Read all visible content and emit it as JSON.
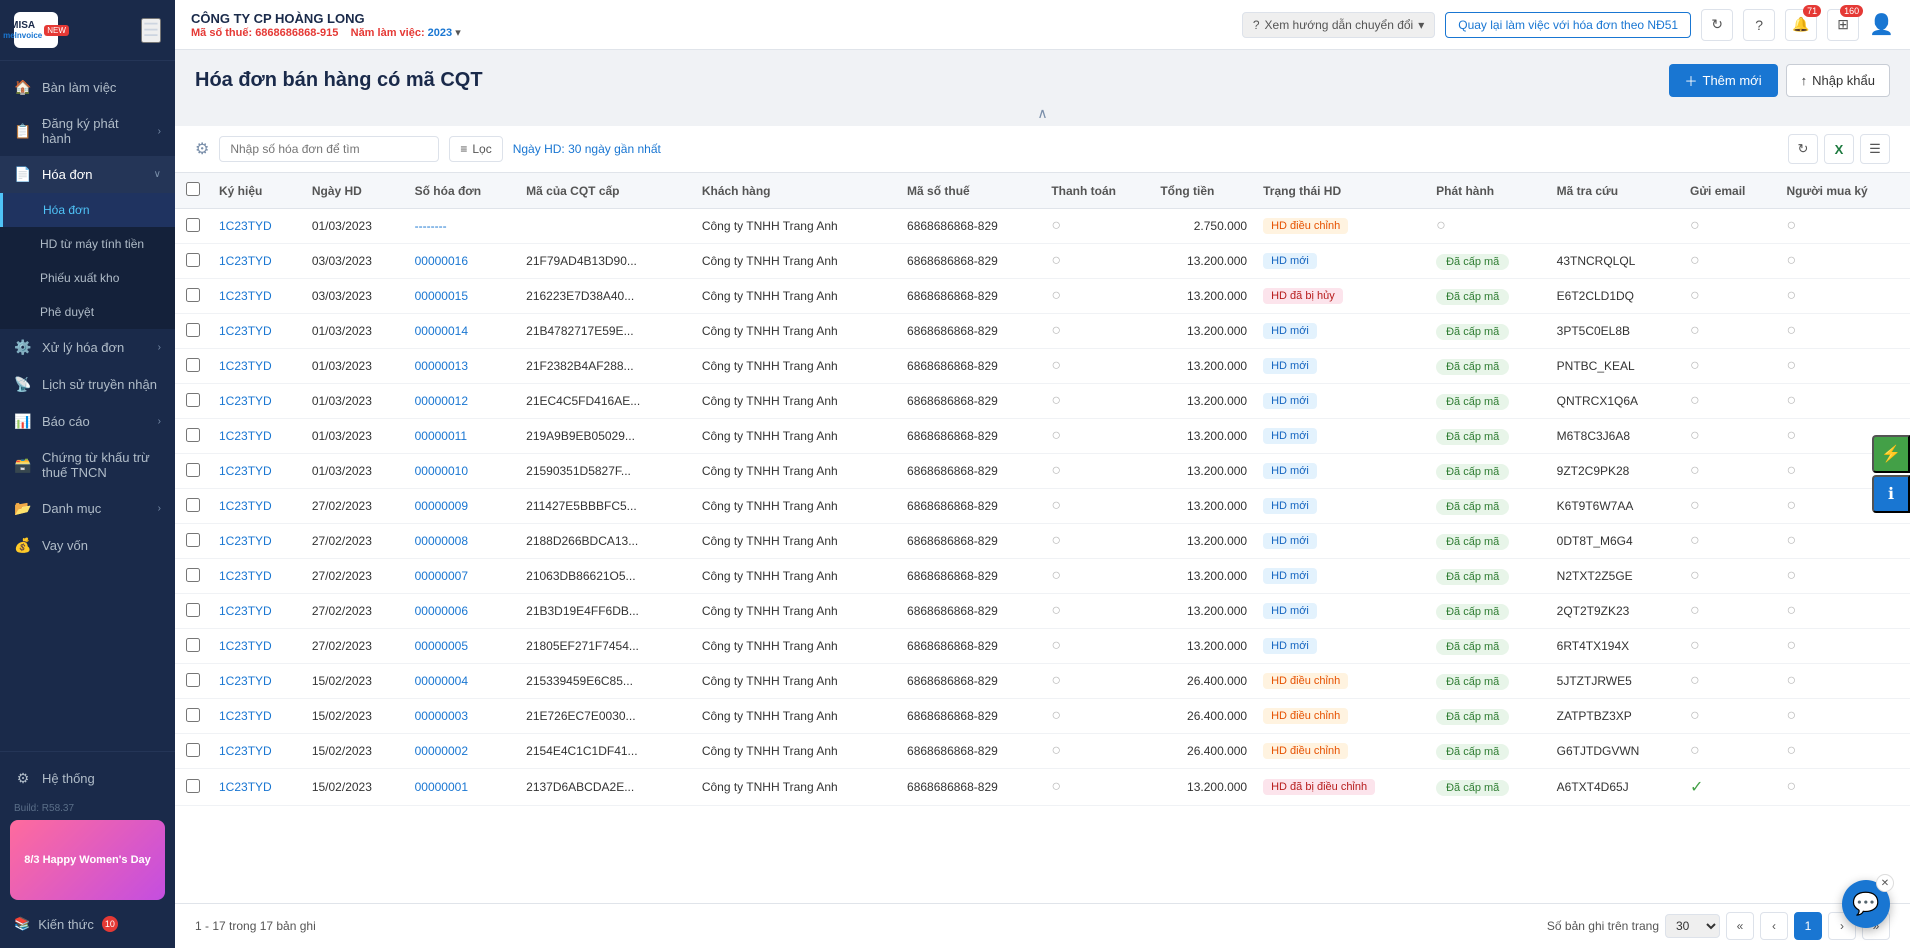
{
  "app": {
    "name": "MISA",
    "sub": "meInvoice",
    "badge": "NEW"
  },
  "company": {
    "name": "CÔNG TY CP HOÀNG LONG",
    "tax_label": "Mã số thuế:",
    "tax_number": "6868686868-915",
    "year_label": "Năm làm việc:",
    "year": "2023"
  },
  "header": {
    "help_text": "Xem hướng dẫn chuyển đổi",
    "nd51_btn": "Quay lại làm việc với hóa đơn theo NĐ51",
    "notification_count": "71",
    "apps_count": "160"
  },
  "page": {
    "title": "Hóa đơn bán hàng có mã CQT",
    "add_btn": "Thêm mới",
    "import_btn": "Nhập khẩu"
  },
  "filter": {
    "search_placeholder": "Nhập số hóa đơn để tìm",
    "filter_label": "Lọc",
    "date_label": "Ngày HD:",
    "date_range": "30 ngày gần nhất"
  },
  "table": {
    "columns": [
      "Ký hiệu",
      "Ngày HD",
      "Số hóa đơn",
      "Mã của CQT cấp",
      "Khách hàng",
      "Mã số thuế",
      "Thanh toán",
      "Tổng tiền",
      "Trạng thái HD",
      "Phát hành",
      "Mã tra cứu",
      "Gửi email",
      "Người mua ký"
    ],
    "rows": [
      {
        "ky_hieu": "1C23TYD",
        "ngay_hd": "01/03/2023",
        "so_hd": "--------",
        "ma_cqt": "",
        "khach_hang": "Công ty TNHH Trang Anh",
        "ma_so_thue": "6868686868-829",
        "thanh_toan": "",
        "tong_tien": "2.750.000",
        "trang_thai": "HD điều chỉnh",
        "trang_thai_class": "badge-hd-dieu-chinh",
        "phat_hanh": "",
        "ma_tra_cuu": "",
        "gui_email": "",
        "nguoi_mua_ky": ""
      },
      {
        "ky_hieu": "1C23TYD",
        "ngay_hd": "03/03/2023",
        "so_hd": "00000016",
        "ma_cqt": "21F79AD4B13D90...",
        "khach_hang": "Công ty TNHH Trang Anh",
        "ma_so_thue": "6868686868-829",
        "thanh_toan": "",
        "tong_tien": "13.200.000",
        "trang_thai": "HD mới",
        "trang_thai_class": "badge-hd-moi",
        "phat_hanh": "Đã cấp mã",
        "ma_tra_cuu": "43TNCRQLQL",
        "gui_email": "",
        "nguoi_mua_ky": ""
      },
      {
        "ky_hieu": "1C23TYD",
        "ngay_hd": "03/03/2023",
        "so_hd": "00000015",
        "ma_cqt": "216223E7D38A40...",
        "khach_hang": "Công ty TNHH Trang Anh",
        "ma_so_thue": "6868686868-829",
        "thanh_toan": "",
        "tong_tien": "13.200.000",
        "trang_thai": "HD đã bị hủy",
        "trang_thai_class": "badge-hd-da-bi-huy",
        "phat_hanh": "Đã cấp mã",
        "ma_tra_cuu": "E6T2CLD1DQ",
        "gui_email": "",
        "nguoi_mua_ky": ""
      },
      {
        "ky_hieu": "1C23TYD",
        "ngay_hd": "01/03/2023",
        "so_hd": "00000014",
        "ma_cqt": "21B4782717E59E...",
        "khach_hang": "Công ty TNHH Trang Anh",
        "ma_so_thue": "6868686868-829",
        "thanh_toan": "",
        "tong_tien": "13.200.000",
        "trang_thai": "HD mới",
        "trang_thai_class": "badge-hd-moi",
        "phat_hanh": "Đã cấp mã",
        "ma_tra_cuu": "3PT5C0EL8B",
        "gui_email": "",
        "nguoi_mua_ky": ""
      },
      {
        "ky_hieu": "1C23TYD",
        "ngay_hd": "01/03/2023",
        "so_hd": "00000013",
        "ma_cqt": "21F2382B4AF288...",
        "khach_hang": "Công ty TNHH Trang Anh",
        "ma_so_thue": "6868686868-829",
        "thanh_toan": "",
        "tong_tien": "13.200.000",
        "trang_thai": "HD mới",
        "trang_thai_class": "badge-hd-moi",
        "phat_hanh": "Đã cấp mã",
        "ma_tra_cuu": "PNTBC_KEAL",
        "gui_email": "",
        "nguoi_mua_ky": ""
      },
      {
        "ky_hieu": "1C23TYD",
        "ngay_hd": "01/03/2023",
        "so_hd": "00000012",
        "ma_cqt": "21EC4C5FD416AE...",
        "khach_hang": "Công ty TNHH Trang Anh",
        "ma_so_thue": "6868686868-829",
        "thanh_toan": "",
        "tong_tien": "13.200.000",
        "trang_thai": "HD mới",
        "trang_thai_class": "badge-hd-moi",
        "phat_hanh": "Đã cấp mã",
        "ma_tra_cuu": "QNTRCX1Q6A",
        "gui_email": "",
        "nguoi_mua_ky": ""
      },
      {
        "ky_hieu": "1C23TYD",
        "ngay_hd": "01/03/2023",
        "so_hd": "00000011",
        "ma_cqt": "219A9B9EB05029...",
        "khach_hang": "Công ty TNHH Trang Anh",
        "ma_so_thue": "6868686868-829",
        "thanh_toan": "",
        "tong_tien": "13.200.000",
        "trang_thai": "HD mới",
        "trang_thai_class": "badge-hd-moi",
        "phat_hanh": "Đã cấp mã",
        "ma_tra_cuu": "M6T8C3J6A8",
        "gui_email": "",
        "nguoi_mua_ky": ""
      },
      {
        "ky_hieu": "1C23TYD",
        "ngay_hd": "01/03/2023",
        "so_hd": "00000010",
        "ma_cqt": "21590351D5827F...",
        "khach_hang": "Công ty TNHH Trang Anh",
        "ma_so_thue": "6868686868-829",
        "thanh_toan": "",
        "tong_tien": "13.200.000",
        "trang_thai": "HD mới",
        "trang_thai_class": "badge-hd-moi",
        "phat_hanh": "Đã cấp mã",
        "ma_tra_cuu": "9ZT2C9PK28",
        "gui_email": "",
        "nguoi_mua_ky": ""
      },
      {
        "ky_hieu": "1C23TYD",
        "ngay_hd": "27/02/2023",
        "so_hd": "00000009",
        "ma_cqt": "211427E5BBBFC5...",
        "khach_hang": "Công ty TNHH Trang Anh",
        "ma_so_thue": "6868686868-829",
        "thanh_toan": "",
        "tong_tien": "13.200.000",
        "trang_thai": "HD mới",
        "trang_thai_class": "badge-hd-moi",
        "phat_hanh": "Đã cấp mã",
        "ma_tra_cuu": "K6T9T6W7AA",
        "gui_email": "",
        "nguoi_mua_ky": ""
      },
      {
        "ky_hieu": "1C23TYD",
        "ngay_hd": "27/02/2023",
        "so_hd": "00000008",
        "ma_cqt": "2188D266BDCA13...",
        "khach_hang": "Công ty TNHH Trang Anh",
        "ma_so_thue": "6868686868-829",
        "thanh_toan": "",
        "tong_tien": "13.200.000",
        "trang_thai": "HD mới",
        "trang_thai_class": "badge-hd-moi",
        "phat_hanh": "Đã cấp mã",
        "ma_tra_cuu": "0DT8T_M6G4",
        "gui_email": "",
        "nguoi_mua_ky": ""
      },
      {
        "ky_hieu": "1C23TYD",
        "ngay_hd": "27/02/2023",
        "so_hd": "00000007",
        "ma_cqt": "21063DB86621O5...",
        "khach_hang": "Công ty TNHH Trang Anh",
        "ma_so_thue": "6868686868-829",
        "thanh_toan": "",
        "tong_tien": "13.200.000",
        "trang_thai": "HD mới",
        "trang_thai_class": "badge-hd-moi",
        "phat_hanh": "Đã cấp mã",
        "ma_tra_cuu": "N2TXT2Z5GE",
        "gui_email": "",
        "nguoi_mua_ky": ""
      },
      {
        "ky_hieu": "1C23TYD",
        "ngay_hd": "27/02/2023",
        "so_hd": "00000006",
        "ma_cqt": "21B3D19E4FF6DB...",
        "khach_hang": "Công ty TNHH Trang Anh",
        "ma_so_thue": "6868686868-829",
        "thanh_toan": "",
        "tong_tien": "13.200.000",
        "trang_thai": "HD mới",
        "trang_thai_class": "badge-hd-moi",
        "phat_hanh": "Đã cấp mã",
        "ma_tra_cuu": "2QT2T9ZK23",
        "gui_email": "",
        "nguoi_mua_ky": ""
      },
      {
        "ky_hieu": "1C23TYD",
        "ngay_hd": "27/02/2023",
        "so_hd": "00000005",
        "ma_cqt": "21805EF271F7454...",
        "khach_hang": "Công ty TNHH Trang Anh",
        "ma_so_thue": "6868686868-829",
        "thanh_toan": "",
        "tong_tien": "13.200.000",
        "trang_thai": "HD mới",
        "trang_thai_class": "badge-hd-moi",
        "phat_hanh": "Đã cấp mã",
        "ma_tra_cuu": "6RT4TX194X",
        "gui_email": "",
        "nguoi_mua_ky": ""
      },
      {
        "ky_hieu": "1C23TYD",
        "ngay_hd": "15/02/2023",
        "so_hd": "00000004",
        "ma_cqt": "215339459E6C85...",
        "khach_hang": "Công ty TNHH Trang Anh",
        "ma_so_thue": "6868686868-829",
        "thanh_toan": "",
        "tong_tien": "26.400.000",
        "trang_thai": "HD điều chỉnh",
        "trang_thai_class": "badge-hd-dieu-chinh",
        "phat_hanh": "Đã cấp mã",
        "ma_tra_cuu": "5JTZTJRWE5",
        "gui_email": "",
        "nguoi_mua_ky": ""
      },
      {
        "ky_hieu": "1C23TYD",
        "ngay_hd": "15/02/2023",
        "so_hd": "00000003",
        "ma_cqt": "21E726EC7E0030...",
        "khach_hang": "Công ty TNHH Trang Anh",
        "ma_so_thue": "6868686868-829",
        "thanh_toan": "",
        "tong_tien": "26.400.000",
        "trang_thai": "HD điều chỉnh",
        "trang_thai_class": "badge-hd-dieu-chinh",
        "phat_hanh": "Đã cấp mã",
        "ma_tra_cuu": "ZATPTBZ3XP",
        "gui_email": "",
        "nguoi_mua_ky": ""
      },
      {
        "ky_hieu": "1C23TYD",
        "ngay_hd": "15/02/2023",
        "so_hd": "00000002",
        "ma_cqt": "2154E4C1C1DF41...",
        "khach_hang": "Công ty TNHH Trang Anh",
        "ma_so_thue": "6868686868-829",
        "thanh_toan": "",
        "tong_tien": "26.400.000",
        "trang_thai": "HD điều chỉnh",
        "trang_thai_class": "badge-hd-dieu-chinh",
        "phat_hanh": "Đã cấp mã",
        "ma_tra_cuu": "G6TJTDGVWN",
        "gui_email": "",
        "nguoi_mua_ky": ""
      },
      {
        "ky_hieu": "1C23TYD",
        "ngay_hd": "15/02/2023",
        "so_hd": "00000001",
        "ma_cqt": "2137D6ABCDA2E...",
        "khach_hang": "Công ty TNHH Trang Anh",
        "ma_so_thue": "6868686868-829",
        "thanh_toan": "",
        "tong_tien": "13.200.000",
        "trang_thai": "HD đã bị điều chỉnh",
        "trang_thai_class": "badge-hd-da-bi-dieu-chinh",
        "phat_hanh": "Đã cấp mã",
        "ma_tra_cuu": "A6TXT4D65J",
        "gui_email": "check",
        "nguoi_mua_ky": ""
      }
    ]
  },
  "pagination": {
    "info": "1 - 17 trong 17 bản ghi",
    "size_label": "Số bản ghi trên trang",
    "size_value": "30",
    "current_page": "1"
  },
  "sidebar": {
    "items": [
      {
        "label": "Bàn làm việc",
        "icon": "🏠",
        "has_sub": false
      },
      {
        "label": "Đăng ký phát hành",
        "icon": "📋",
        "has_sub": true
      },
      {
        "label": "Hóa đơn",
        "icon": "📄",
        "has_sub": true,
        "active": true
      },
      {
        "label": "Xử lý hóa đơn",
        "icon": "⚙️",
        "has_sub": true
      },
      {
        "label": "Lịch sử truyền nhận",
        "icon": "📡",
        "has_sub": false
      },
      {
        "label": "Báo cáo",
        "icon": "📊",
        "has_sub": true
      },
      {
        "label": "Chứng từ khấu trừ thuế TNCN",
        "icon": "🗃️",
        "has_sub": false
      },
      {
        "label": "Danh mục",
        "icon": "📂",
        "has_sub": true
      },
      {
        "label": "Vay vốn",
        "icon": "💰",
        "has_sub": false
      }
    ],
    "sub_items": [
      {
        "label": "Hóa đơn",
        "active": true
      },
      {
        "label": "HD từ máy tính tiền",
        "active": false
      },
      {
        "label": "Phiếu xuất kho",
        "active": false
      },
      {
        "label": "Phê duyệt",
        "active": false
      }
    ],
    "bottom": {
      "he_thong": "Hệ thống",
      "build": "Build: R58.37",
      "kien_thuc": "Kiến thức",
      "kien_thuc_badge": "10"
    }
  }
}
